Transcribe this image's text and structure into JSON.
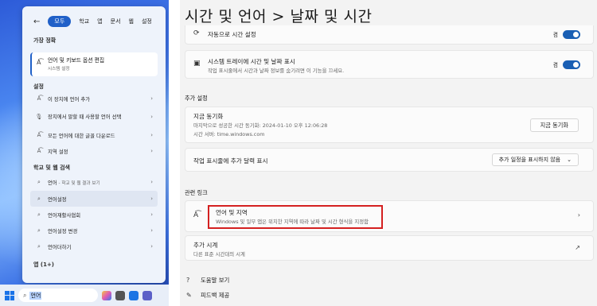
{
  "start_panel": {
    "tabs": [
      "모두",
      "학교",
      "앱",
      "문서",
      "웹",
      "설정"
    ],
    "best_match_header": "가장 정확",
    "best_match": {
      "title": "언어 및 키보드 옵션 편집",
      "subtitle": "시스템 설정"
    },
    "settings_header": "설정",
    "settings_items": [
      "이 장치에 언어 추가",
      "장치에서 말할 때 사용할 언어 선택",
      "모든 언어에 대한 글꼴 다운로드",
      "지역 설정"
    ],
    "web_header": "학교 및 웹 검색",
    "web_items": [
      {
        "label": "언어",
        "suffix": " - 학교 및 웹 결과 보기"
      },
      {
        "label": "언어설정",
        "suffix": ""
      },
      {
        "label": "언어재활사협회",
        "suffix": ""
      },
      {
        "label": "언어설정 변경",
        "suffix": ""
      },
      {
        "label": "언어더하기",
        "suffix": ""
      }
    ],
    "apps_header": "앱 (1+)"
  },
  "taskbar": {
    "search_text": "언어"
  },
  "settings": {
    "title": "시간 및 언어  >  날짜 및 시간",
    "auto_time": {
      "label": "자동으로 시간 설정",
      "state": "켬"
    },
    "tray": {
      "label": "시스템 트레이에 시간 및 날짜 표시",
      "desc": "작업 표시줄에서 시간과 날짜 정보를 숨기려면 이 기능을 끄세요.",
      "state": "켬"
    },
    "extra_header": "추가 설정",
    "sync": {
      "label": "지금 동기화",
      "last": "마지막으로 성공한 시간 동기화: 2024-01-10 오후 12:06:28",
      "server": "시간 서버: time.windows.com",
      "button": "지금 동기화"
    },
    "calendar": {
      "label": "작업 표시줄에 추가 달력 표시",
      "value": "추가 일정을 표시하지 않음"
    },
    "related_header": "관련 링크",
    "region": {
      "label": "언어 및 지역",
      "desc": "Windows 및 일부 앱은 위치한 지역에 따라 날짜 및 시간 형식을 지정함"
    },
    "clocks": {
      "label": "추가 시계",
      "desc": "다른 표준 시간대의 시계"
    },
    "help": "도움말 보기",
    "feedback": "피드백 제공"
  }
}
